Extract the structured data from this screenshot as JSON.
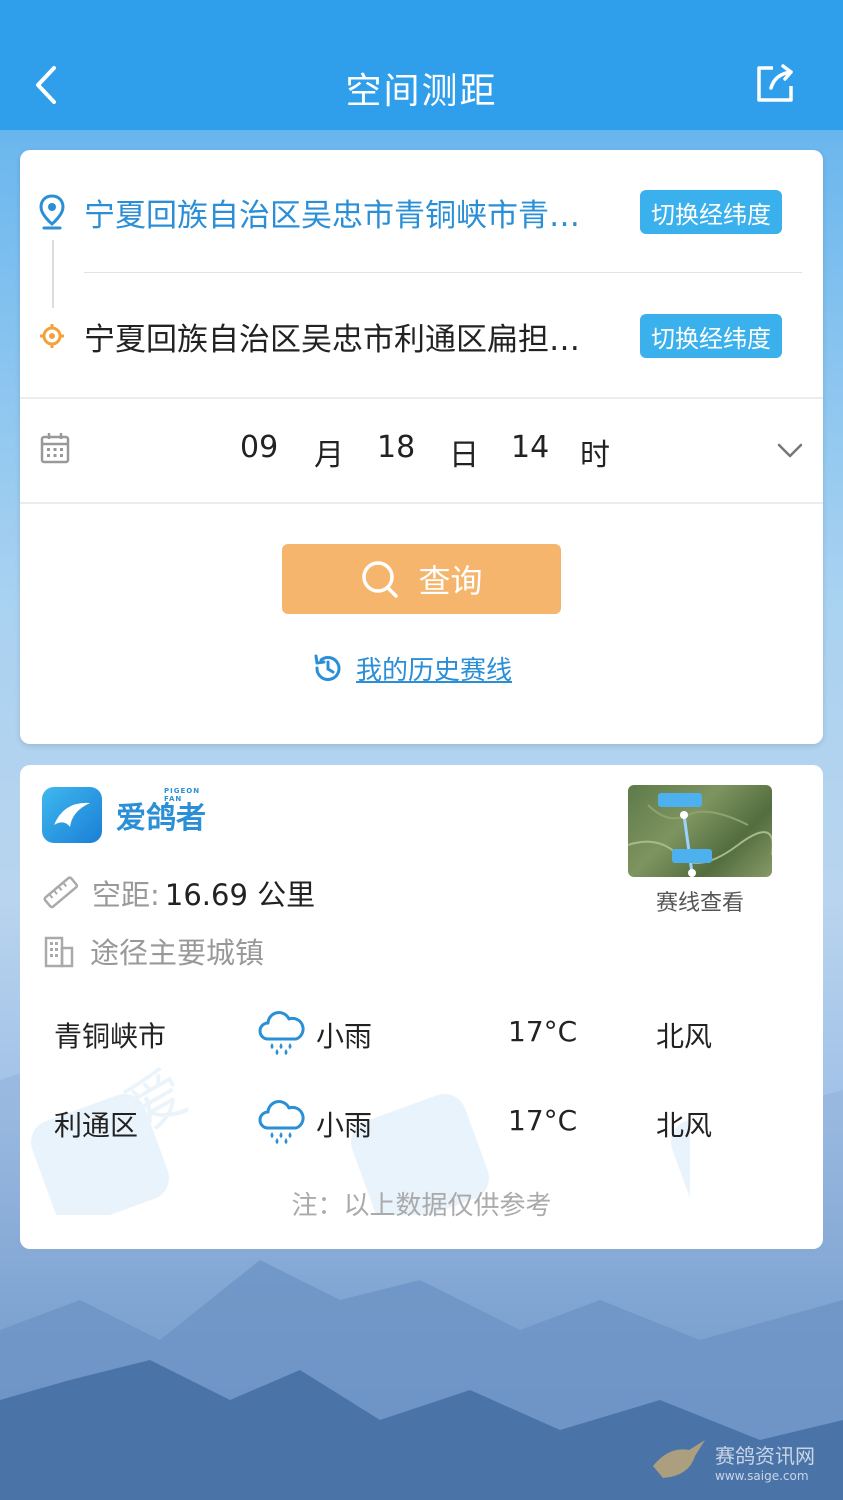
{
  "header": {
    "title": "空间测距"
  },
  "route": {
    "start": {
      "address": "宁夏回族自治区吴忠市青铜峡市青…",
      "switch_label": "切换经纬度"
    },
    "end": {
      "address": "宁夏回族自治区吴忠市利通区扁担…",
      "switch_label": "切换经纬度"
    }
  },
  "datetime": {
    "month": "09",
    "month_unit": "月",
    "day": "18",
    "day_unit": "日",
    "hour": "14",
    "hour_unit": "时"
  },
  "actions": {
    "query_label": "查询",
    "history_label": "我的历史赛线"
  },
  "result": {
    "brand_name": "爱鸽者",
    "brand_sub": "PIGEON FAN",
    "map_label": "赛线查看",
    "distance_label": "空距",
    "distance_sep": ":",
    "distance_value": "16.69 公里",
    "cities_label": "途径主要城镇",
    "weather": [
      {
        "city": "青铜峡市",
        "condition": "小雨",
        "temp": "17°C",
        "wind": "北风"
      },
      {
        "city": "利通区",
        "condition": "小雨",
        "temp": "17°C",
        "wind": "北风"
      }
    ],
    "note": "注：以上数据仅供参考"
  },
  "corner": {
    "name": "赛鸽资讯网",
    "url": "www.saige.com"
  },
  "colors": {
    "header": "#2f9fec",
    "accent_blue": "#2a8fd6",
    "switch_btn": "#3ab0ec",
    "query_btn": "#f6b56c",
    "start_pin": "#2a8fd6",
    "end_pin": "#f3a23a"
  }
}
